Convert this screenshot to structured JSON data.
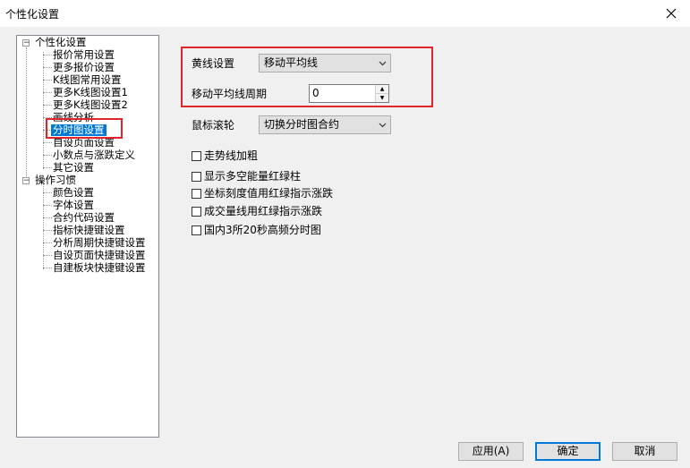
{
  "window": {
    "title": "个性化设置"
  },
  "tree": {
    "groups": [
      {
        "label": "个性化设置",
        "items": [
          "报价常用设置",
          "更多报价设置",
          "K线图常用设置",
          "更多K线图设置1",
          "更多K线图设置2",
          "画线分析",
          "分时图设置",
          "自设页面设置",
          "小数点与涨跌定义",
          "其它设置"
        ]
      },
      {
        "label": "操作习惯",
        "items": [
          "颜色设置",
          "字体设置",
          "合约代码设置",
          "指标快捷键设置",
          "分析周期快捷键设置",
          "自设页面快捷键设置",
          "自建板块快捷键设置"
        ]
      }
    ],
    "selected": "分时图设置"
  },
  "settings": {
    "yellow_line_label": "黄线设置",
    "yellow_line_value": "移动平均线",
    "ma_period_label": "移动平均线周期",
    "ma_period_value": "0",
    "mouse_wheel_label": "鼠标滚轮",
    "mouse_wheel_value": "切换分时图合约"
  },
  "checkboxes": [
    "走势线加粗",
    "显示多空能量红绿柱",
    "坐标刻度值用红绿指示涨跌",
    "成交量线用红绿指示涨跌",
    "国内3所20秒高频分时图"
  ],
  "buttons": {
    "apply": "应用(A)",
    "ok": "确定",
    "cancel": "取消"
  },
  "colors": {
    "selection": "#0078d7",
    "highlight_box": "#e0262a",
    "default_button_border": "#0078d7"
  }
}
